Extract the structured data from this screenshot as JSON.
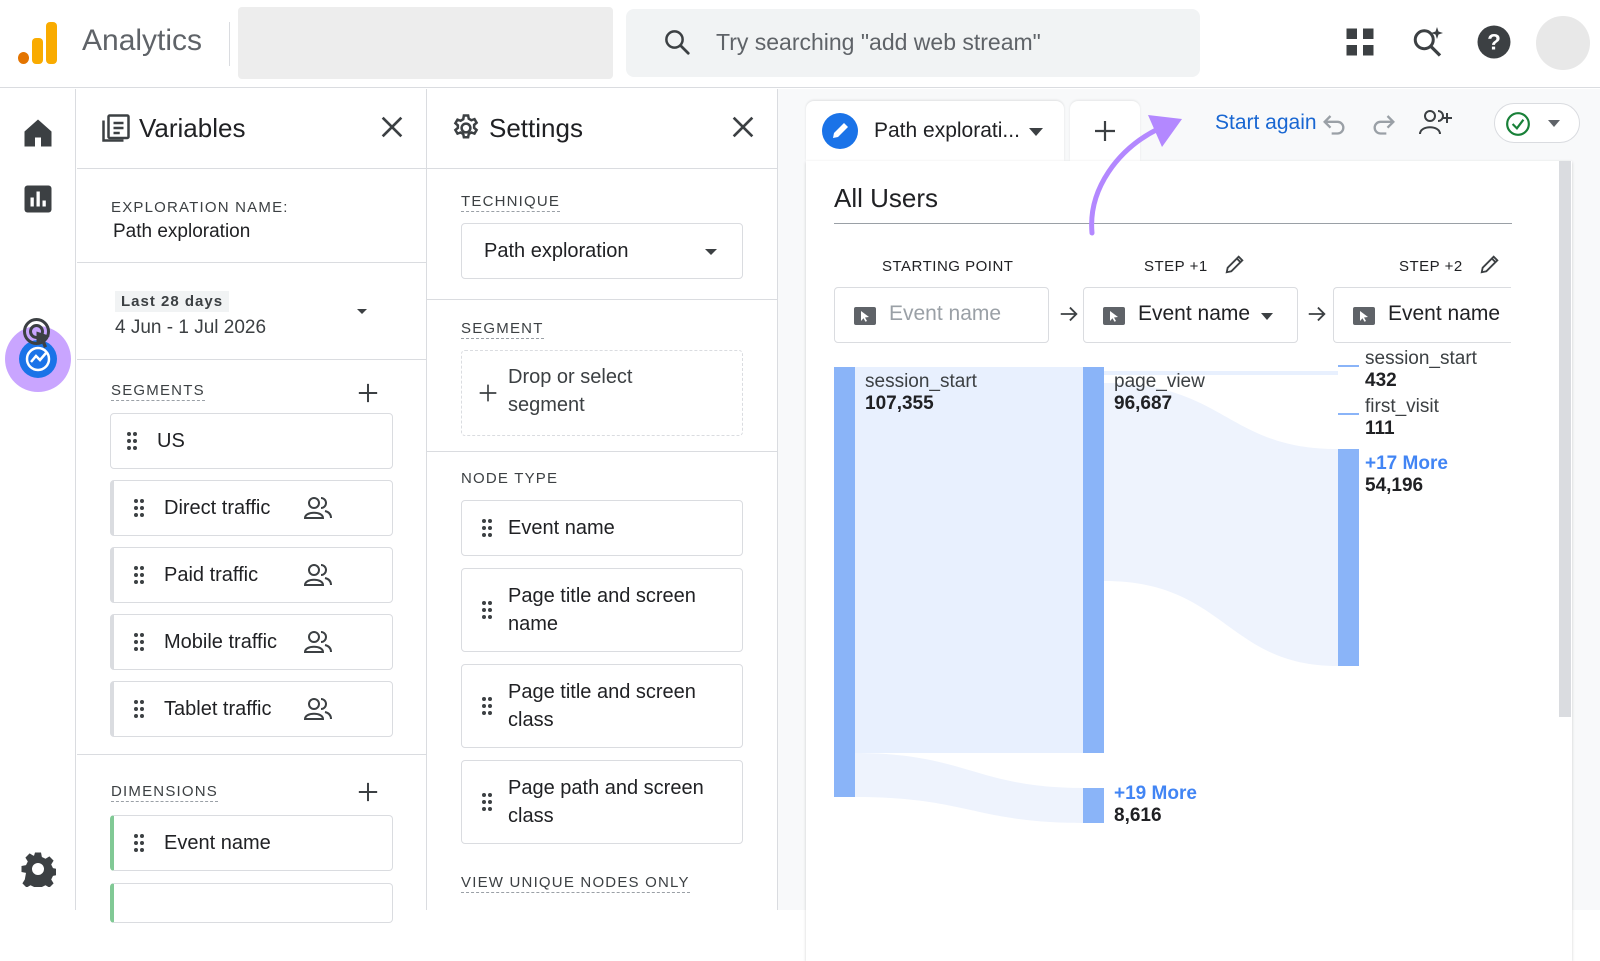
{
  "header": {
    "brand": "Analytics",
    "search_placeholder": "Try searching \"add web stream\"",
    "colors": {
      "logo_orange": "#f9ab00",
      "logo_dark": "#e37400"
    }
  },
  "leftnav": {
    "items": [
      {
        "name": "home-icon"
      },
      {
        "name": "reports-icon"
      },
      {
        "name": "explore-icon",
        "active": true
      },
      {
        "name": "advertising-icon"
      },
      {
        "name": "admin-gear-icon"
      }
    ]
  },
  "variables": {
    "title": "Variables",
    "exploration_label": "EXPLORATION NAME:",
    "exploration_name": "Path exploration",
    "date_label": "Last 28 days",
    "date_range": "4 Jun - 1 Jul 2026",
    "segments_label": "SEGMENTS",
    "segments": [
      {
        "label": "US",
        "users_icon": false
      },
      {
        "label": "Direct traffic",
        "users_icon": true
      },
      {
        "label": "Paid traffic",
        "users_icon": true
      },
      {
        "label": "Mobile traffic",
        "users_icon": true
      },
      {
        "label": "Tablet traffic",
        "users_icon": true
      }
    ],
    "dimensions_label": "DIMENSIONS",
    "dimensions": [
      {
        "label": "Event name"
      }
    ]
  },
  "settings": {
    "title": "Settings",
    "technique_label": "TECHNIQUE",
    "technique_value": "Path exploration",
    "segment_label": "SEGMENT",
    "segment_drop": "Drop or select segment",
    "node_type_label": "NODE TYPE",
    "node_types": [
      "Event name",
      "Page title and screen name",
      "Page title and screen class",
      "Page path and screen class"
    ],
    "view_unique": "VIEW UNIQUE NODES ONLY"
  },
  "canvas": {
    "tab_label": "Path explorati...",
    "start_again": "Start again",
    "segment_title": "All Users",
    "steps": [
      {
        "header": "STARTING POINT",
        "field": "Event name",
        "placeholder": true
      },
      {
        "header": "STEP +1",
        "field": "Event name",
        "placeholder": false
      },
      {
        "header": "STEP +2",
        "field": "Event name",
        "placeholder": false
      }
    ],
    "nodes": {
      "start": [
        {
          "label": "session_start",
          "value": "107,355"
        }
      ],
      "step1": [
        {
          "label": "page_view",
          "value": "96,687"
        },
        {
          "label": "+19 More",
          "value": "8,616",
          "more": true
        }
      ],
      "step2": [
        {
          "label": "session_start",
          "value": "432"
        },
        {
          "label": "first_visit",
          "value": "111"
        },
        {
          "label": "+17 More",
          "value": "54,196",
          "more": true
        }
      ]
    },
    "colors": {
      "bar": "#8ab4f8",
      "flow": "#e8f0fe",
      "annotation_arrow": "#b388ff"
    }
  }
}
